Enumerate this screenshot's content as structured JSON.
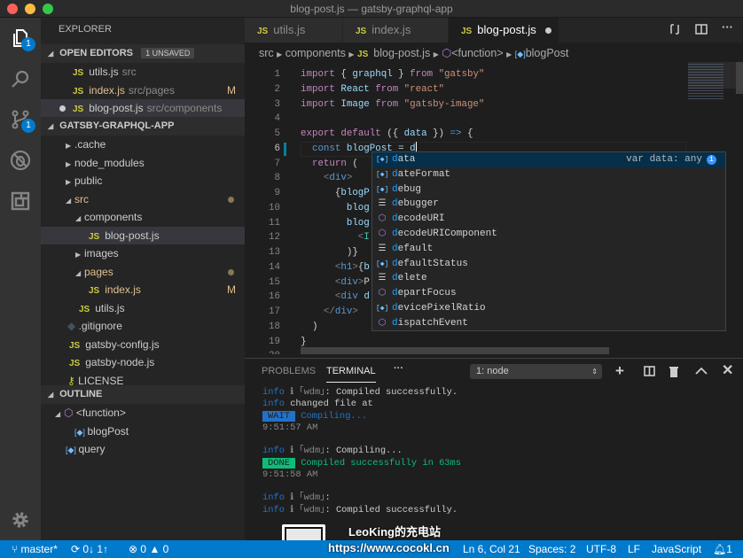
{
  "window": {
    "title": "blog-post.js — gatsby-graphql-app"
  },
  "activity": {
    "explorer_badge": "1",
    "scm_badge": "1"
  },
  "sidebar": {
    "title": "EXPLORER",
    "open_editors": {
      "label": "OPEN EDITORS",
      "badge": "1 UNSAVED",
      "items": [
        {
          "name": "utils.js",
          "path": "src",
          "mod": ""
        },
        {
          "name": "index.js",
          "path": "src/pages",
          "mod": "M"
        },
        {
          "name": "blog-post.js",
          "path": "src/components",
          "mod": ""
        }
      ]
    },
    "project": {
      "label": "GATSBY-GRAPHQL-APP",
      "items": [
        {
          "name": ".cache",
          "type": "folder",
          "open": false,
          "depth": 0
        },
        {
          "name": "node_modules",
          "type": "folder",
          "open": false,
          "depth": 0
        },
        {
          "name": "public",
          "type": "folder",
          "open": false,
          "depth": 0
        },
        {
          "name": "src",
          "type": "folder",
          "open": true,
          "depth": 0,
          "mod": "dot"
        },
        {
          "name": "components",
          "type": "folder",
          "open": true,
          "depth": 1
        },
        {
          "name": "blog-post.js",
          "type": "js",
          "depth": 2,
          "selected": true
        },
        {
          "name": "images",
          "type": "folder",
          "open": false,
          "depth": 1
        },
        {
          "name": "pages",
          "type": "folder",
          "open": true,
          "depth": 1,
          "mod": "dot"
        },
        {
          "name": "index.js",
          "type": "js",
          "depth": 2,
          "mod": "M"
        },
        {
          "name": "utils.js",
          "type": "js",
          "depth": 1
        },
        {
          "name": ".gitignore",
          "type": "git",
          "depth": 0
        },
        {
          "name": "gatsby-config.js",
          "type": "js",
          "depth": 0
        },
        {
          "name": "gatsby-node.js",
          "type": "js",
          "depth": 0
        },
        {
          "name": "LICENSE",
          "type": "license",
          "depth": 0
        }
      ]
    },
    "outline": {
      "label": "OUTLINE",
      "items": [
        {
          "name": "<function>",
          "kind": "function",
          "depth": 0
        },
        {
          "name": "blogPost",
          "kind": "variable",
          "depth": 1
        },
        {
          "name": "query",
          "kind": "variable",
          "depth": 0
        }
      ]
    }
  },
  "tabs": [
    {
      "label": "utils.js"
    },
    {
      "label": "index.js"
    },
    {
      "label": "blog-post.js",
      "active": true,
      "dirty": true
    }
  ],
  "breadcrumb": [
    "src",
    "components",
    "blog-post.js",
    "<function>",
    "blogPost"
  ],
  "code": {
    "lines": [
      [
        [
          "import",
          "kw"
        ],
        [
          " { ",
          ""
        ],
        [
          "graphql",
          "vr"
        ],
        [
          " } ",
          ""
        ],
        [
          "from",
          "kw"
        ],
        [
          " ",
          ""
        ],
        [
          "\"gatsby\"",
          "st"
        ]
      ],
      [
        [
          "import",
          "kw"
        ],
        [
          " ",
          ""
        ],
        [
          "React",
          "vr"
        ],
        [
          " ",
          ""
        ],
        [
          "from",
          "kw"
        ],
        [
          " ",
          ""
        ],
        [
          "\"react\"",
          "st"
        ]
      ],
      [
        [
          "import",
          "kw"
        ],
        [
          " ",
          ""
        ],
        [
          "Image",
          "vr"
        ],
        [
          " ",
          ""
        ],
        [
          "from",
          "kw"
        ],
        [
          " ",
          ""
        ],
        [
          "\"gatsby-image\"",
          "st"
        ]
      ],
      [],
      [
        [
          "export",
          "kw"
        ],
        [
          " ",
          ""
        ],
        [
          "default",
          "kw"
        ],
        [
          " ({ ",
          ""
        ],
        [
          "data",
          "vr"
        ],
        [
          " }) ",
          ""
        ],
        [
          "=>",
          "dk"
        ],
        [
          " {",
          ""
        ]
      ],
      [
        [
          "  ",
          ""
        ],
        [
          "const",
          "dk"
        ],
        [
          " ",
          ""
        ],
        [
          "blogPost",
          "vr"
        ],
        [
          " = ",
          ""
        ],
        [
          "d",
          "vr"
        ]
      ],
      [
        [
          "  ",
          ""
        ],
        [
          "return",
          "kw"
        ],
        [
          " (",
          ""
        ]
      ],
      [
        [
          "    ",
          ""
        ],
        [
          "<",
          "tg"
        ],
        [
          "div",
          "ta"
        ],
        [
          ">",
          "tg"
        ]
      ],
      [
        [
          "      {",
          ""
        ],
        [
          "blogP",
          "vr"
        ]
      ],
      [
        [
          "        ",
          ""
        ],
        [
          "blog",
          "vr"
        ]
      ],
      [
        [
          "        ",
          ""
        ],
        [
          "blog",
          "vr"
        ]
      ],
      [
        [
          "          ",
          ""
        ],
        [
          "<",
          "tg"
        ],
        [
          "I",
          "cm"
        ]
      ],
      [
        [
          "        )}",
          ""
        ]
      ],
      [
        [
          "      ",
          ""
        ],
        [
          "<",
          "tg"
        ],
        [
          "h1",
          "ta"
        ],
        [
          ">",
          "tg"
        ],
        [
          "{",
          ""
        ],
        [
          "b",
          "vr"
        ]
      ],
      [
        [
          "      ",
          ""
        ],
        [
          "<",
          "tg"
        ],
        [
          "div",
          "ta"
        ],
        [
          ">",
          "tg"
        ],
        [
          "P",
          ""
        ]
      ],
      [
        [
          "      ",
          ""
        ],
        [
          "<",
          "tg"
        ],
        [
          "div",
          "ta"
        ],
        [
          " ",
          ""
        ],
        [
          "d",
          "vr"
        ]
      ],
      [
        [
          "    ",
          ""
        ],
        [
          "</",
          "tg"
        ],
        [
          "div",
          "ta"
        ],
        [
          ">",
          "tg"
        ]
      ],
      [
        [
          "  )",
          ""
        ]
      ],
      [
        [
          "}",
          ""
        ]
      ],
      []
    ],
    "current_line": 6
  },
  "suggest": {
    "detail": "var data: any",
    "items": [
      {
        "label": "data",
        "kind": "variable"
      },
      {
        "label": "dateFormat",
        "kind": "variable"
      },
      {
        "label": "debug",
        "kind": "variable"
      },
      {
        "label": "debugger",
        "kind": "keyword"
      },
      {
        "label": "decodeURI",
        "kind": "method"
      },
      {
        "label": "decodeURIComponent",
        "kind": "method"
      },
      {
        "label": "default",
        "kind": "keyword"
      },
      {
        "label": "defaultStatus",
        "kind": "variable"
      },
      {
        "label": "delete",
        "kind": "keyword"
      },
      {
        "label": "departFocus",
        "kind": "method"
      },
      {
        "label": "devicePixelRatio",
        "kind": "variable"
      },
      {
        "label": "dispatchEvent",
        "kind": "method"
      }
    ]
  },
  "panel": {
    "tabs": [
      "PROBLEMS",
      "TERMINAL"
    ],
    "active_tab": "TERMINAL",
    "terminal_select": "1: node",
    "lines": [
      [
        [
          "info",
          "ti"
        ],
        [
          " ℹ ｢wdm｣",
          "tg2"
        ],
        [
          ": Compiled successfully.",
          ""
        ]
      ],
      [
        [
          "info",
          "ti"
        ],
        [
          " changed file at",
          ""
        ]
      ],
      [
        [
          "WAIT",
          "tw1"
        ],
        [
          " Compiling...",
          "tb"
        ]
      ],
      [
        [
          "9:51:57 AM",
          "tg2"
        ]
      ],
      [],
      [
        [
          "info",
          "ti"
        ],
        [
          " ℹ ｢wdm｣",
          "tg2"
        ],
        [
          ": Compiling...",
          ""
        ]
      ],
      [
        [
          "DONE",
          "td"
        ],
        [
          " Compiled successfully in 63ms",
          "tgn"
        ]
      ],
      [
        [
          "9:51:58 AM",
          "tg2"
        ]
      ],
      [],
      [
        [
          "info",
          "ti"
        ],
        [
          " ℹ ｢wdm｣",
          "tg2"
        ],
        [
          ":",
          ""
        ]
      ],
      [
        [
          "info",
          "ti"
        ],
        [
          " ℹ ｢wdm｣",
          "tg2"
        ],
        [
          ": Compiled successfully.",
          ""
        ]
      ]
    ]
  },
  "status": {
    "branch": "master*",
    "sync": "0↓ 1↑",
    "errors": "0",
    "warnings": "0",
    "position": "Ln 6, Col 21",
    "spaces": "Spaces: 2",
    "encoding": "UTF-8",
    "eol": "LF",
    "language": "JavaScript",
    "notifications": "1"
  },
  "watermark": {
    "line1": "LeoKing的充电站",
    "line2": "https://www.cocokl.cn"
  },
  "colors": {
    "accent": "#007acc",
    "statusbar": "#007acc",
    "selection": "#062f4a",
    "js_icon": "#cbcb41",
    "modified": "#e2c08d"
  }
}
